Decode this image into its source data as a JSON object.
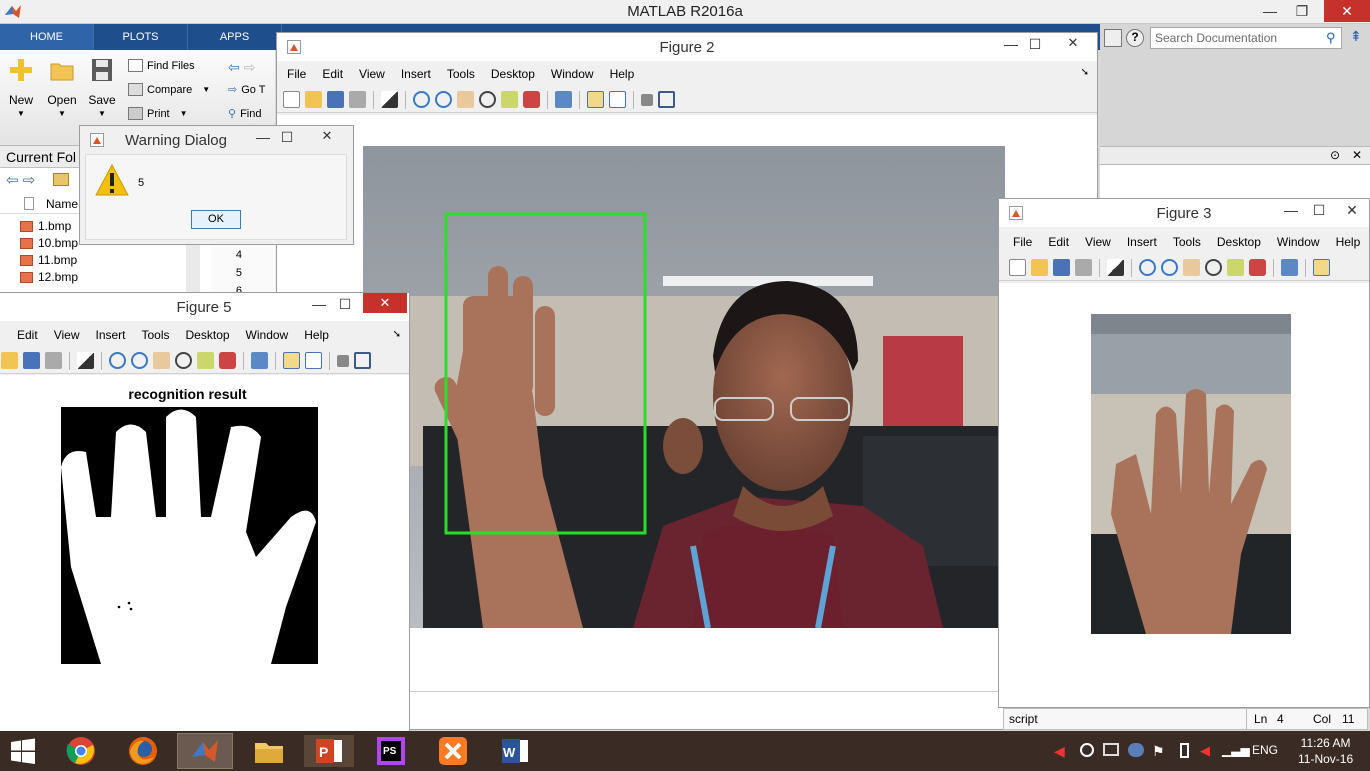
{
  "app": {
    "title": "MATLAB R2016a",
    "controls": {
      "minimize": "—",
      "restore": "❐",
      "close": "✕"
    }
  },
  "toolstrip": {
    "tabs": [
      "HOME",
      "PLOTS",
      "APPS"
    ],
    "big_buttons": [
      "New",
      "Open",
      "Save"
    ],
    "small_buttons": {
      "find_files": "Find Files",
      "compare": "Compare",
      "print": "Print",
      "go_to": "Go T",
      "find": "Find"
    }
  },
  "search": {
    "placeholder": "Search Documentation"
  },
  "current_folder": {
    "title": "Current Fol",
    "column": "Name",
    "files": [
      "1.bmp",
      "10.bmp",
      "11.bmp",
      "12.bmp"
    ],
    "line_numbers": [
      "4",
      "5",
      "6"
    ]
  },
  "warning_dialog": {
    "title": "Warning Dialog",
    "message": "5",
    "ok": "OK"
  },
  "menus": [
    "File",
    "Edit",
    "View",
    "Insert",
    "Tools",
    "Desktop",
    "Window",
    "Help"
  ],
  "figure2": {
    "title": "Figure 2"
  },
  "figure3": {
    "title": "Figure 3"
  },
  "figure5": {
    "title": "Figure 5",
    "axes_title": "recognition result"
  },
  "status": {
    "mode": "script",
    "ln_label": "Ln",
    "ln_value": "4",
    "col_label": "Col",
    "col_value": "11"
  },
  "taskbar": {
    "time": "11:26 AM",
    "date": "11-Nov-16",
    "lang": "ENG"
  },
  "colors": {
    "ribbon_tab_bg": "#1e4e8c",
    "close_red": "#c7312b",
    "detection_box": "#2adf2a",
    "taskbar_bg": "#3a2c24"
  }
}
